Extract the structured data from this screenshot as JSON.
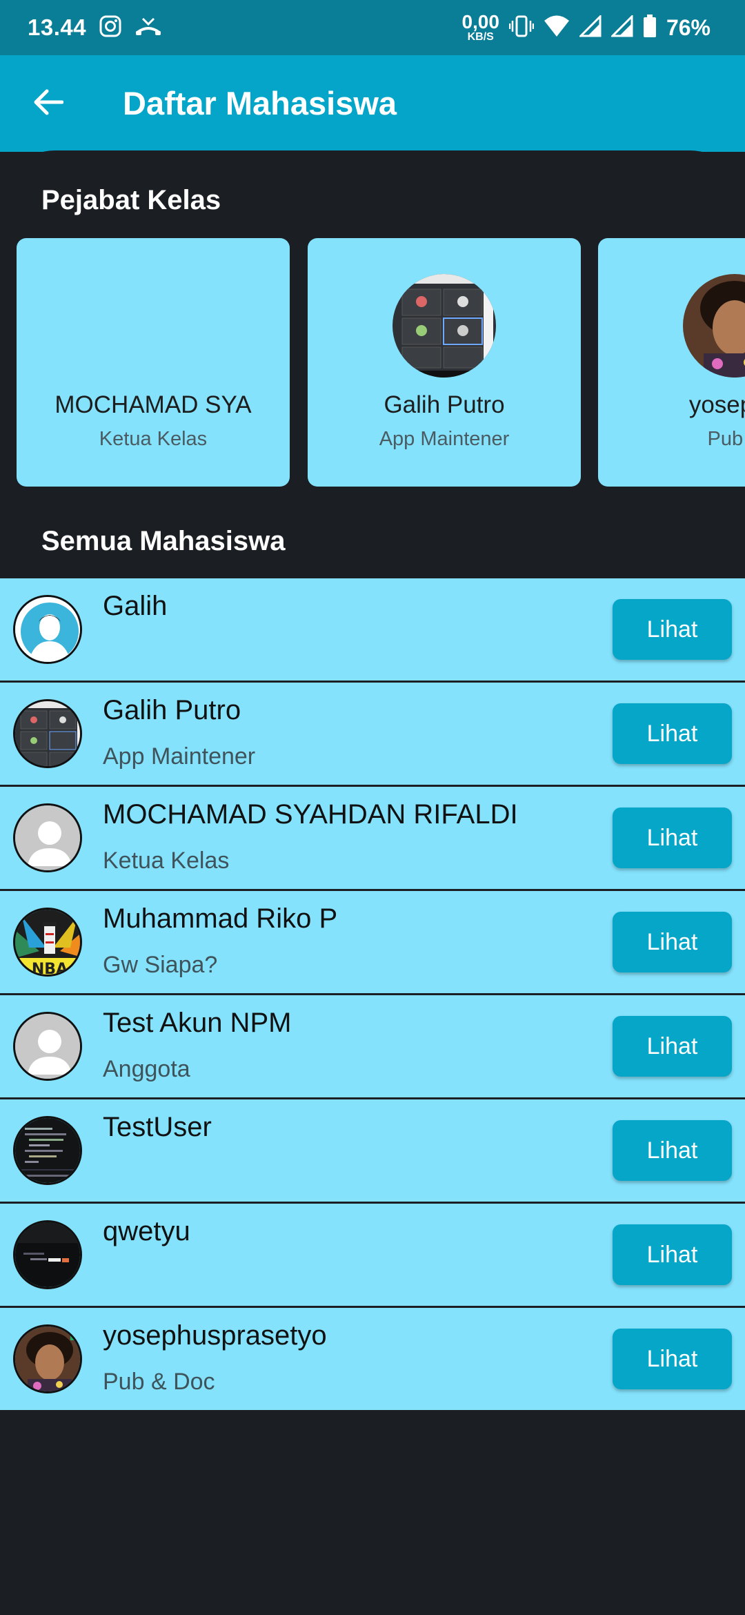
{
  "status_bar": {
    "time": "13.44",
    "net_speed_value": "0,00",
    "net_speed_unit": "KB/S",
    "battery": "76%"
  },
  "app_bar": {
    "title": "Daftar Mahasiswa"
  },
  "sections": {
    "officers_title": "Pejabat Kelas",
    "all_title": "Semua Mahasiswa"
  },
  "officers": [
    {
      "name": "MOCHAMAD SYA",
      "role": "Ketua Kelas",
      "avatar": "none"
    },
    {
      "name": "Galih Putro",
      "role": "App Maintener",
      "avatar": "screenshot-thumbnail"
    },
    {
      "name": "yosephu",
      "role": "Pub &",
      "avatar": "person-photo"
    }
  ],
  "students": [
    {
      "name": "Galih",
      "role": "",
      "avatar": "default-male-avatar",
      "button": "Lihat"
    },
    {
      "name": "Galih Putro",
      "role": "App Maintener",
      "avatar": "screenshot-thumbnail",
      "button": "Lihat"
    },
    {
      "name": "MOCHAMAD SYAHDAN RIFALDI",
      "role": "Ketua Kelas",
      "avatar": "placeholder-person",
      "button": "Lihat"
    },
    {
      "name": "Muhammad Riko P",
      "role": "Gw Siapa?",
      "avatar": "logo-emblem",
      "button": "Lihat"
    },
    {
      "name": "Test Akun NPM",
      "role": "Anggota",
      "avatar": "placeholder-person",
      "button": "Lihat"
    },
    {
      "name": "TestUser",
      "role": "",
      "avatar": "code-screenshot",
      "button": "Lihat"
    },
    {
      "name": "qwetyu",
      "role": "",
      "avatar": "dark-screenshot",
      "button": "Lihat"
    },
    {
      "name": "yosephusprasetyo",
      "role": "Pub & Doc",
      "avatar": "person-photo",
      "button": "Lihat"
    }
  ],
  "colors": {
    "status_bar": "#0a7e97",
    "app_bar": "#04a5c9",
    "background": "#1b1e22",
    "card": "#84e2fc",
    "button": "#06a6c9"
  }
}
